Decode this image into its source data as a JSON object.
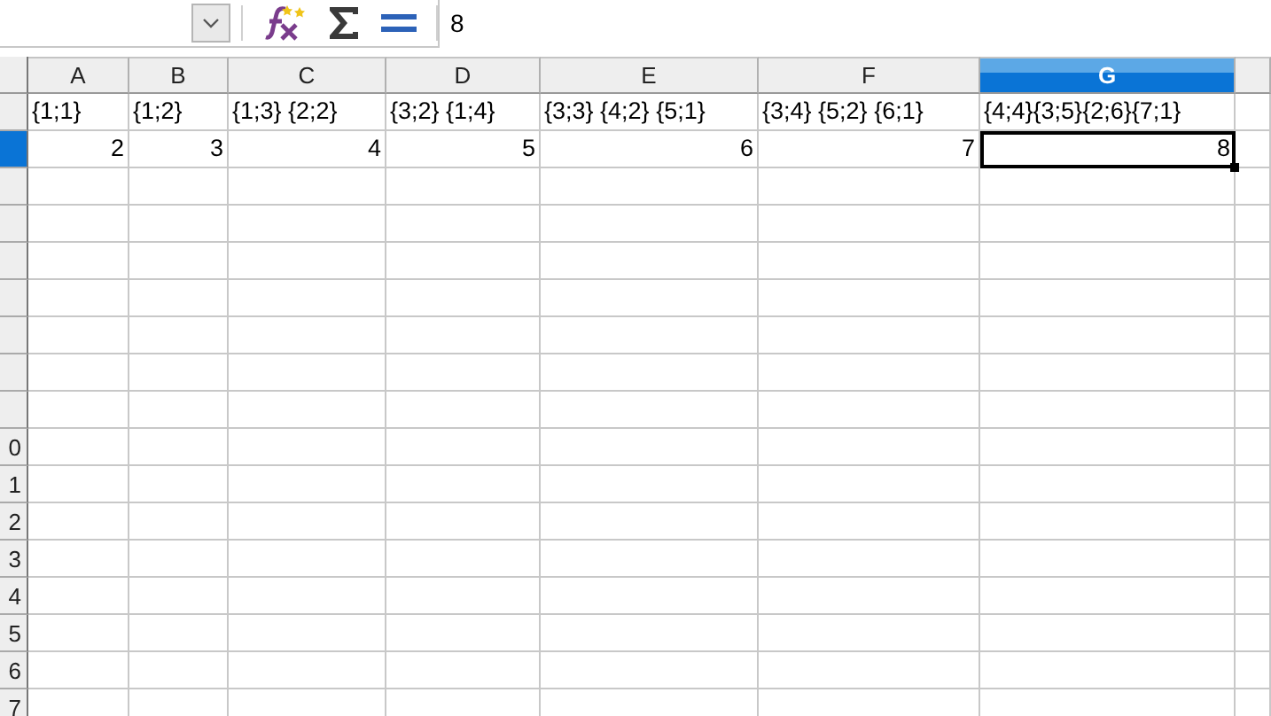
{
  "toolbar": {
    "formula": "8"
  },
  "columns": [
    {
      "label": "A",
      "selected": false
    },
    {
      "label": "B",
      "selected": false
    },
    {
      "label": "C",
      "selected": false
    },
    {
      "label": "D",
      "selected": false
    },
    {
      "label": "E",
      "selected": false
    },
    {
      "label": "F",
      "selected": false
    },
    {
      "label": "G",
      "selected": true
    },
    {
      "selected": false
    }
  ],
  "rows": [
    {
      "selected": false,
      "cells": [
        {
          "value": "{1;1}",
          "kind": "text",
          "selected": false
        },
        {
          "value": "{1;2}",
          "kind": "text",
          "selected": false
        },
        {
          "value": "{1;3} {2;2}",
          "kind": "text",
          "selected": false
        },
        {
          "value": "{3;2} {1;4}",
          "kind": "text",
          "selected": false
        },
        {
          "value": "{3;3} {4;2} {5;1}",
          "kind": "text",
          "selected": false
        },
        {
          "value": "{3;4} {5;2} {6;1}",
          "kind": "text",
          "selected": false
        },
        {
          "value": "{4;4}{3;5}{2;6}{7;1}",
          "kind": "text",
          "selected": false
        }
      ]
    },
    {
      "selected": true,
      "cells": [
        {
          "value": "2",
          "kind": "number",
          "selected": false
        },
        {
          "value": "3",
          "kind": "number",
          "selected": false
        },
        {
          "value": "4",
          "kind": "number",
          "selected": false
        },
        {
          "value": "5",
          "kind": "number",
          "selected": false
        },
        {
          "value": "6",
          "kind": "number",
          "selected": false
        },
        {
          "value": "7",
          "kind": "number",
          "selected": false
        },
        {
          "value": "8",
          "kind": "number",
          "selected": true
        }
      ]
    },
    {
      "selected": false
    },
    {
      "selected": false
    },
    {
      "selected": false
    },
    {
      "selected": false
    },
    {
      "selected": false
    },
    {
      "selected": false
    },
    {
      "selected": false
    },
    {
      "header": "0",
      "selected": false
    },
    {
      "header": "1",
      "selected": false
    },
    {
      "header": "2",
      "selected": false
    },
    {
      "header": "3",
      "selected": false
    },
    {
      "header": "4",
      "selected": false
    },
    {
      "header": "5",
      "selected": false
    },
    {
      "header": "6",
      "selected": false
    },
    {
      "header": "7",
      "selected": false
    }
  ]
}
